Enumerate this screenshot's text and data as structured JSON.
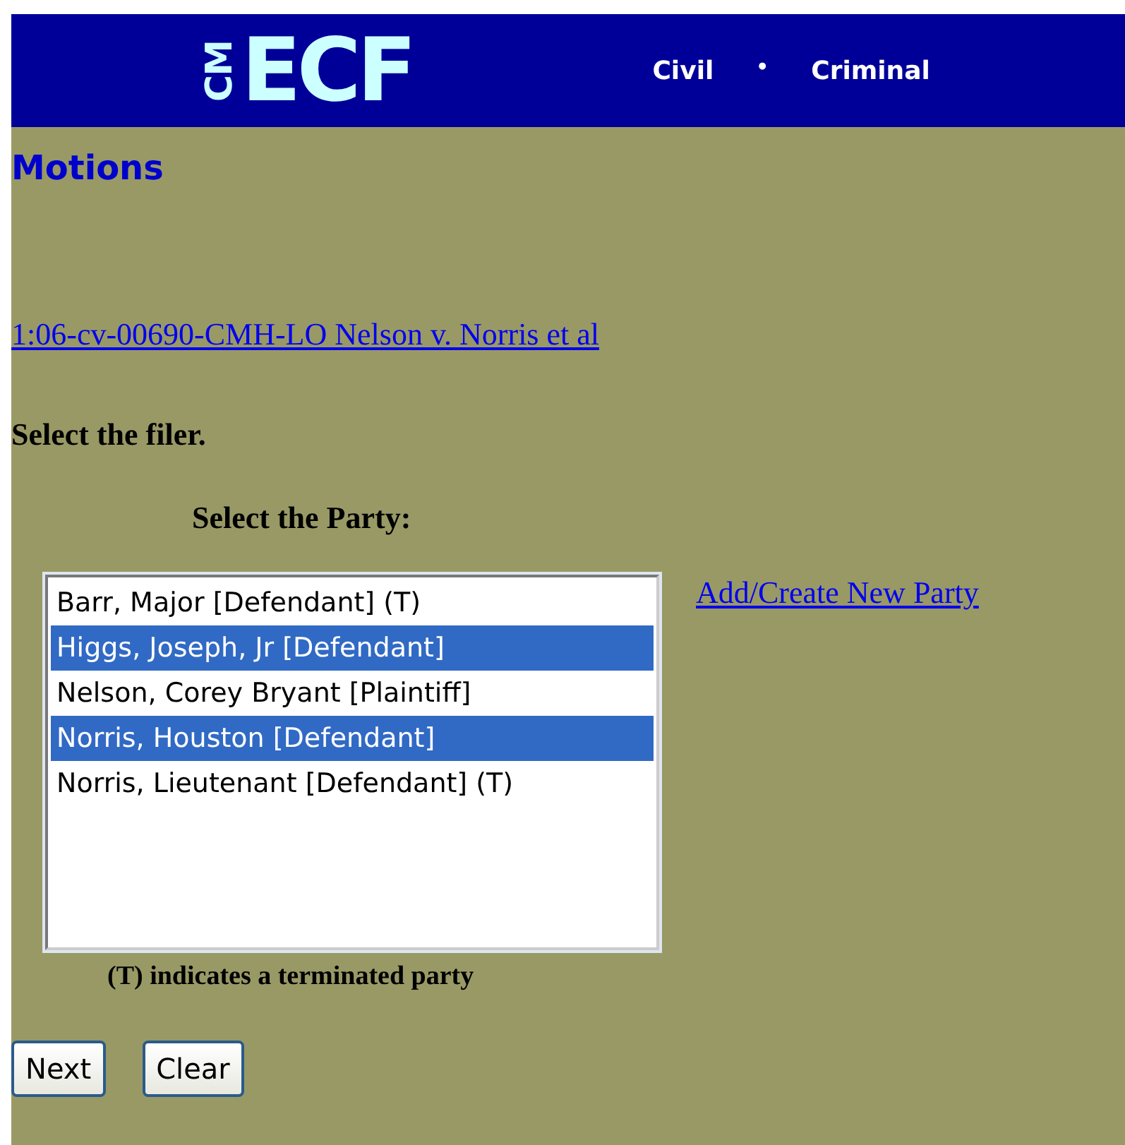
{
  "header": {
    "logo_small": "CM",
    "logo": "ECF",
    "nav": [
      {
        "label": "Civil"
      },
      {
        "label": "•",
        "kind": "separator"
      },
      {
        "label": "Criminal"
      }
    ]
  },
  "title": "Motions",
  "case_link": "1:06-cv-00690-CMH-LO Nelson v. Norris et al",
  "instruction": "Select the filer.",
  "party_label": "Select the Party:",
  "parties": [
    {
      "label": "Barr, Major [Defendant] (T)",
      "selected": false
    },
    {
      "label": "Higgs, Joseph, Jr [Defendant]",
      "selected": true
    },
    {
      "label": "Nelson, Corey Bryant [Plaintiff]",
      "selected": false
    },
    {
      "label": "Norris, Houston [Defendant]",
      "selected": true
    },
    {
      "label": "Norris, Lieutenant [Defendant] (T)",
      "selected": false
    }
  ],
  "add_party_link": "Add/Create New Party",
  "note": "(T) indicates a terminated party",
  "buttons": [
    "Next",
    "Clear"
  ]
}
